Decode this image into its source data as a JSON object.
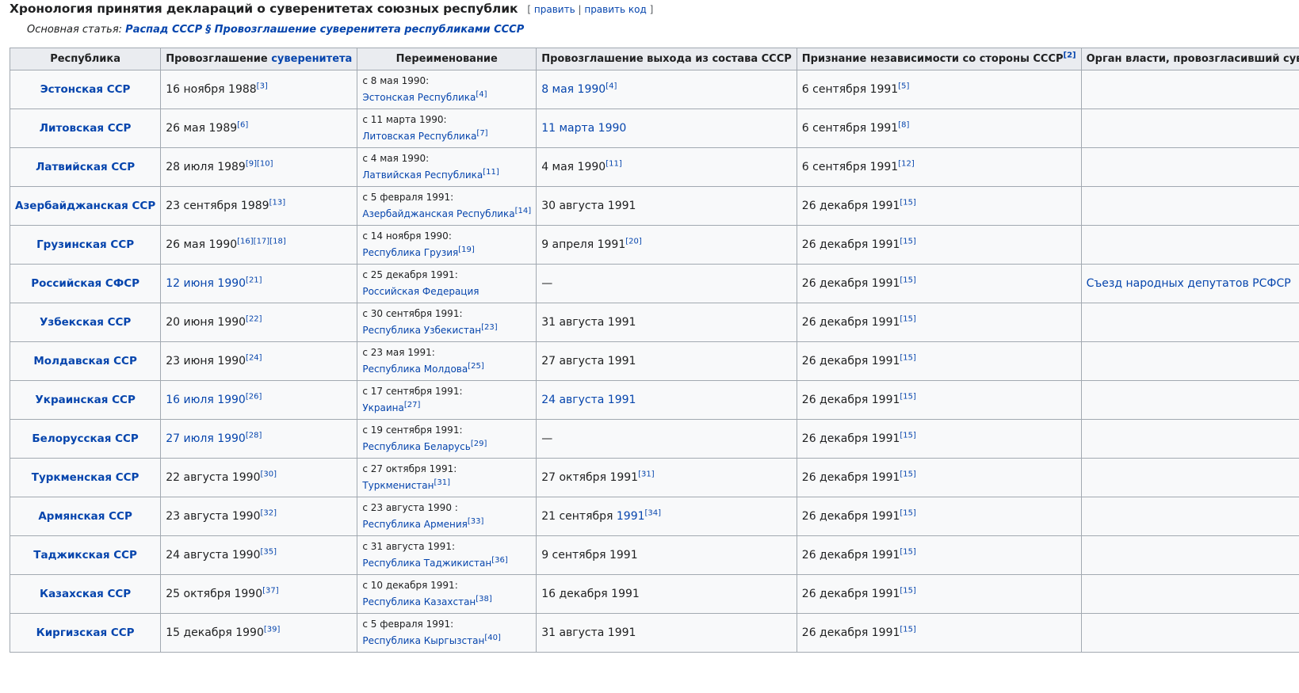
{
  "heading": {
    "title": "Хронология принятия деклараций о суверенитетах союзных республик",
    "edit_open": "[",
    "edit_label": "править",
    "edit_sep": "|",
    "edit_code_label": "править код",
    "edit_close": "]"
  },
  "hatnote": {
    "prefix": "Основная статья: ",
    "link": "Распад СССР § Провозглашение суверенитета республиками СССР"
  },
  "table": {
    "headers": {
      "republic": "Республика",
      "sovereignty_prefix": "Провозглашение ",
      "sovereignty_link": "суверенитета",
      "renaming": "Переименование",
      "exit": "Провозглашение выхода из состава СССР",
      "recognition": "Признание независимости со стороны СССР",
      "recognition_ref": "[2]",
      "authority": "Орган власти, провозгласивший суверенитет"
    },
    "rows": [
      {
        "republic": "Эстонская ССР",
        "sov": "16 ноября 1988",
        "sov_ref": "[3]",
        "ren_date": "с 8 мая 1990:",
        "ren_name": "Эстонская Республика",
        "ren_ref": "[4]",
        "exit": "8 мая 1990",
        "exit_ref": "[4]",
        "rec": "6 сентября 1991",
        "rec_ref": "[5]",
        "auth": ""
      },
      {
        "republic": "Литовская ССР",
        "sov": "26 мая 1989",
        "sov_ref": "[6]",
        "ren_date": "с 11 марта 1990:",
        "ren_name": "Литовская Республика",
        "ren_ref": "[7]",
        "exit": "11 марта 1990",
        "exit_ref": "",
        "rec": "6 сентября 1991",
        "rec_ref": "[8]",
        "auth": ""
      },
      {
        "republic": "Латвийская ССР",
        "sov": "28 июля 1989",
        "sov_ref": "[9][10]",
        "ren_date": "с 4 мая 1990:",
        "ren_name": "Латвийская Республика",
        "ren_ref": "[11]",
        "exit": "4 мая 1990",
        "exit_ref": "[11]",
        "rec": "6 сентября 1991",
        "rec_ref": "[12]",
        "auth": ""
      },
      {
        "republic": "Азербайджанская ССР",
        "sov": "23 сентября 1989",
        "sov_ref": "[13]",
        "ren_date": "с 5 февраля 1991:",
        "ren_name": "Азербайджанская Республика",
        "ren_ref": "[14]",
        "exit": "30 августа 1991",
        "exit_ref": "",
        "rec": "26 декабря 1991",
        "rec_ref": "[15]",
        "auth": ""
      },
      {
        "republic": "Грузинская ССР",
        "sov": "26 мая 1990",
        "sov_ref": "[16][17][18]",
        "ren_date": "с 14 ноября 1990:",
        "ren_name": "Республика Грузия",
        "ren_ref": "[19]",
        "exit": "9 апреля 1991",
        "exit_ref": "[20]",
        "rec": "26 декабря 1991",
        "rec_ref": "[15]",
        "auth": ""
      },
      {
        "republic": "Российская СФСР",
        "sov": "12 июня 1990",
        "sov_ref": "[21]",
        "ren_date": "с 25 декабря 1991:",
        "ren_name": "Российская Федерация",
        "ren_ref": "",
        "exit": "—",
        "exit_ref": "",
        "rec": "26 декабря 1991",
        "rec_ref": "[15]",
        "auth": "Съезд народных депутатов РСФСР"
      },
      {
        "republic": "Узбекская ССР",
        "sov": "20 июня 1990",
        "sov_ref": "[22]",
        "ren_date": "с 30 сентября 1991:",
        "ren_name": "Республика Узбекистан",
        "ren_ref": "[23]",
        "exit": "31 августа 1991",
        "exit_ref": "",
        "rec": "26 декабря 1991",
        "rec_ref": "[15]",
        "auth": ""
      },
      {
        "republic": "Молдавская ССР",
        "sov": "23 июня 1990",
        "sov_ref": "[24]",
        "ren_date": "с 23 мая 1991:",
        "ren_name": "Республика Молдова",
        "ren_ref": "[25]",
        "exit": "27 августа 1991",
        "exit_ref": "",
        "rec": "26 декабря 1991",
        "rec_ref": "[15]",
        "auth": ""
      },
      {
        "republic": "Украинская ССР",
        "sov": "16 июля 1990",
        "sov_ref": "[26]",
        "ren_date": "с 17 сентября 1991:",
        "ren_name": "Украина",
        "ren_ref": "[27]",
        "exit": "24 августа 1991",
        "exit_ref": "",
        "rec": "26 декабря 1991",
        "rec_ref": "[15]",
        "auth": ""
      },
      {
        "republic": "Белорусская ССР",
        "sov": "27 июля 1990",
        "sov_ref": "[28]",
        "ren_date": "с 19 сентября 1991:",
        "ren_name": "Республика Беларусь",
        "ren_ref": "[29]",
        "exit": "—",
        "exit_ref": "",
        "rec": "26 декабря 1991",
        "rec_ref": "[15]",
        "auth": ""
      },
      {
        "republic": "Туркменская ССР",
        "sov": "22 августа 1990",
        "sov_ref": "[30]",
        "ren_date": "с 27 октября 1991:",
        "ren_name": "Туркменистан",
        "ren_ref": "[31]",
        "exit": "27 октября 1991",
        "exit_ref": "[31]",
        "rec": "26 декабря 1991",
        "rec_ref": "[15]",
        "auth": ""
      },
      {
        "republic": "Армянская ССР",
        "sov": "23 августа 1990",
        "sov_ref": "[32]",
        "ren_date": "с 23 августа 1990 :",
        "ren_name": "Республика Армения",
        "ren_ref": "[33]",
        "exit": "21 сентября ",
        "exit_link": "1991",
        "exit_ref": "[34]",
        "rec": "26 декабря 1991",
        "rec_ref": "[15]",
        "auth": ""
      },
      {
        "republic": "Таджикская ССР",
        "sov": "24 августа 1990",
        "sov_ref": "[35]",
        "ren_date": "с 31 августа 1991:",
        "ren_name": "Республика Таджикистан",
        "ren_ref": "[36]",
        "exit": "9 сентября 1991",
        "exit_ref": "",
        "rec": "26 декабря 1991",
        "rec_ref": "[15]",
        "auth": ""
      },
      {
        "republic": "Казахская ССР",
        "sov": "25 октября 1990",
        "sov_ref": "[37]",
        "ren_date": "с 10 декабря 1991:",
        "ren_name": "Республика Казахстан",
        "ren_ref": "[38]",
        "exit": "16 декабря 1991",
        "exit_ref": "",
        "rec": "26 декабря 1991",
        "rec_ref": "[15]",
        "auth": ""
      },
      {
        "republic": "Киргизская ССР",
        "sov": "15 декабря 1990",
        "sov_ref": "[39]",
        "ren_date": "с 5 февраля 1991:",
        "ren_name": "Республика Кыргызстан",
        "ren_ref": "[40]",
        "exit": "31 августа 1991",
        "exit_ref": "",
        "rec": "26 декабря 1991",
        "rec_ref": "[15]",
        "auth": ""
      }
    ]
  }
}
